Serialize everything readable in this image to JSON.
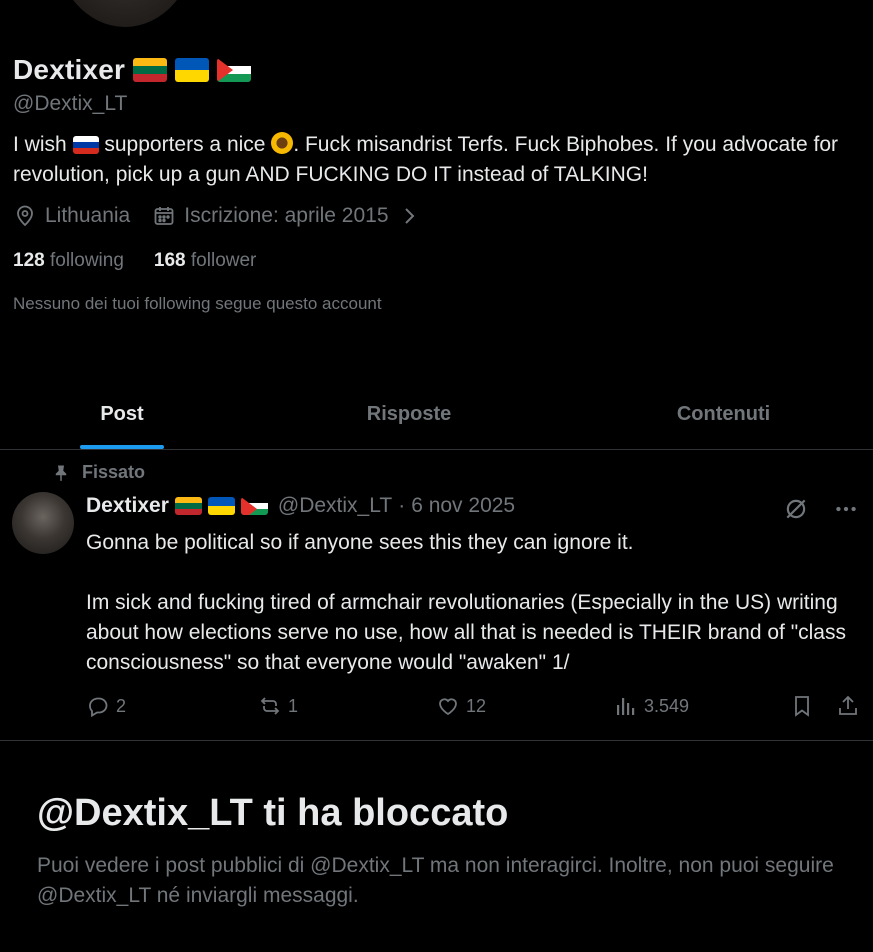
{
  "profile": {
    "name": "Dextixer",
    "handle": "@Dextix_LT",
    "bio_part1": "I wish",
    "bio_part2": "supporters a nice",
    "bio_part3": ". Fuck misandrist Terfs. Fuck Biphobes. If you advocate for revolution, pick up a gun AND FUCKING DO IT instead of TALKING!",
    "location": "Lithuania",
    "joined": "Iscrizione: aprile 2015",
    "following_count": "128",
    "following_label": "following",
    "follower_count": "168",
    "follower_label": "follower",
    "no_followers_known": "Nessuno dei tuoi following segue questo account",
    "flags": [
      "flag-lithuania-icon",
      "flag-ukraine-icon",
      "flag-palestine-icon"
    ]
  },
  "tabs": [
    {
      "label": "Post",
      "active": true
    },
    {
      "label": "Risposte",
      "active": false
    },
    {
      "label": "Contenuti",
      "active": false
    }
  ],
  "tweet": {
    "pinned_label": "Fissato",
    "name": "Dextixer",
    "handle": "@Dextix_LT",
    "separator": "·",
    "date": "6 nov 2025",
    "text": "Gonna be political so if anyone sees this they can ignore it.\n\nIm sick and fucking tired of armchair revolutionaries (Especially in the US) writing about how elections serve no use, how all that is needed is THEIR brand of \"class consciousness\" so that everyone would \"awaken\" 1/",
    "replies": "2",
    "reposts": "1",
    "likes": "12",
    "views": "3.549"
  },
  "blocked": {
    "title": "@Dextix_LT ti ha bloccato",
    "message": "Puoi vedere i post pubblici di @Dextix_LT ma non interagirci. Inoltre, non puoi seguire @Dextix_LT né inviargli messaggi."
  },
  "colors": {
    "background": "#000000",
    "text": "#e7e9ea",
    "muted": "#71767b",
    "accent": "#1d9bf0",
    "border": "#2f3336"
  }
}
